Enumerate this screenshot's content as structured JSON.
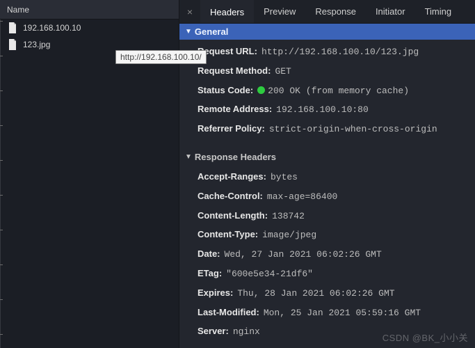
{
  "left": {
    "header": "Name",
    "files": [
      {
        "name": "192.168.100.10"
      },
      {
        "name": "123.jpg"
      }
    ],
    "tooltip": "http://192.168.100.10/"
  },
  "tabs": {
    "close_glyph": "×",
    "items": [
      {
        "label": "Headers",
        "active": true
      },
      {
        "label": "Preview",
        "active": false
      },
      {
        "label": "Response",
        "active": false
      },
      {
        "label": "Initiator",
        "active": false
      },
      {
        "label": "Timing",
        "active": false
      }
    ]
  },
  "sections": {
    "general": {
      "title": "General",
      "request_url_k": "Request URL:",
      "request_url_v": "http://192.168.100.10/123.jpg",
      "request_method_k": "Request Method:",
      "request_method_v": "GET",
      "status_code_k": "Status Code:",
      "status_code_v": "200 OK (from memory cache)",
      "remote_addr_k": "Remote Address:",
      "remote_addr_v": "192.168.100.10:80",
      "referrer_k": "Referrer Policy:",
      "referrer_v": "strict-origin-when-cross-origin"
    },
    "response_headers": {
      "title": "Response Headers",
      "accept_ranges_k": "Accept-Ranges:",
      "accept_ranges_v": "bytes",
      "cache_control_k": "Cache-Control:",
      "cache_control_v": "max-age=86400",
      "content_length_k": "Content-Length:",
      "content_length_v": "138742",
      "content_type_k": "Content-Type:",
      "content_type_v": "image/jpeg",
      "date_k": "Date:",
      "date_v": "Wed, 27 Jan 2021 06:02:26 GMT",
      "etag_k": "ETag:",
      "etag_v": "\"600e5e34-21df6\"",
      "expires_k": "Expires:",
      "expires_v": "Thu, 28 Jan 2021 06:02:26 GMT",
      "last_modified_k": "Last-Modified:",
      "last_modified_v": "Mon, 25 Jan 2021 05:59:16 GMT",
      "server_k": "Server:",
      "server_v": "nginx"
    }
  },
  "watermark": "CSDN @BK_小小关"
}
